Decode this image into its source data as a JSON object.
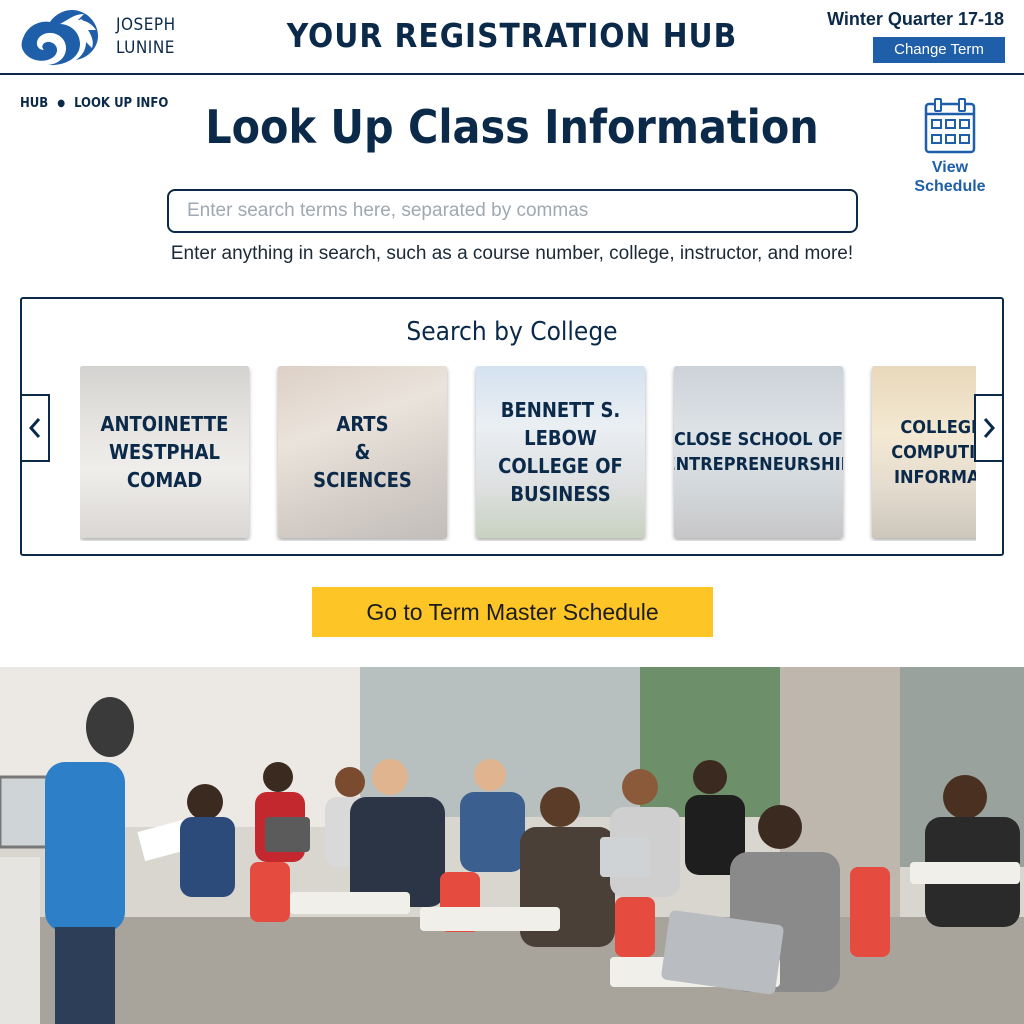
{
  "header": {
    "brand_line1": "JOSEPH",
    "brand_line2": "LUNINE",
    "hub_title": "YOUR REGISTRATION HUB",
    "term": "Winter Quarter 17-18",
    "change_term_label": "Change Term"
  },
  "breadcrumb": {
    "items": [
      "HUB",
      "LOOK UP INFO"
    ]
  },
  "page_title": "Look Up Class Information",
  "view_schedule": {
    "line1": "View",
    "line2": "Schedule"
  },
  "search": {
    "value": "",
    "placeholder": "Enter search terms here, separated by commas",
    "hint": "Enter anything in search, such as a course number, college, instructor, and more!"
  },
  "colleges": {
    "title": "Search by College",
    "items": [
      {
        "label": "ANTOINETTE\nWESTPHAL\nCOMAD"
      },
      {
        "label": "ARTS\n&\nSCIENCES"
      },
      {
        "label": "BENNETT S.\nLEBOW\nCOLLEGE OF\nBUSINESS"
      },
      {
        "label": "CLOSE SCHOOL OF\nENTREPRENEURSHIP"
      },
      {
        "label": "COLLEGE OF\nCOMPUTING &\nINFORMATICS"
      }
    ]
  },
  "master_schedule_label": "Go to Term Master Schedule",
  "colors": {
    "navy": "#0b2a4a",
    "link_blue": "#1f5ea8",
    "gold": "#fdc626"
  },
  "icons": [
    "dragon-logo-icon",
    "calendar-icon",
    "chevron-left-icon",
    "chevron-right-icon"
  ]
}
